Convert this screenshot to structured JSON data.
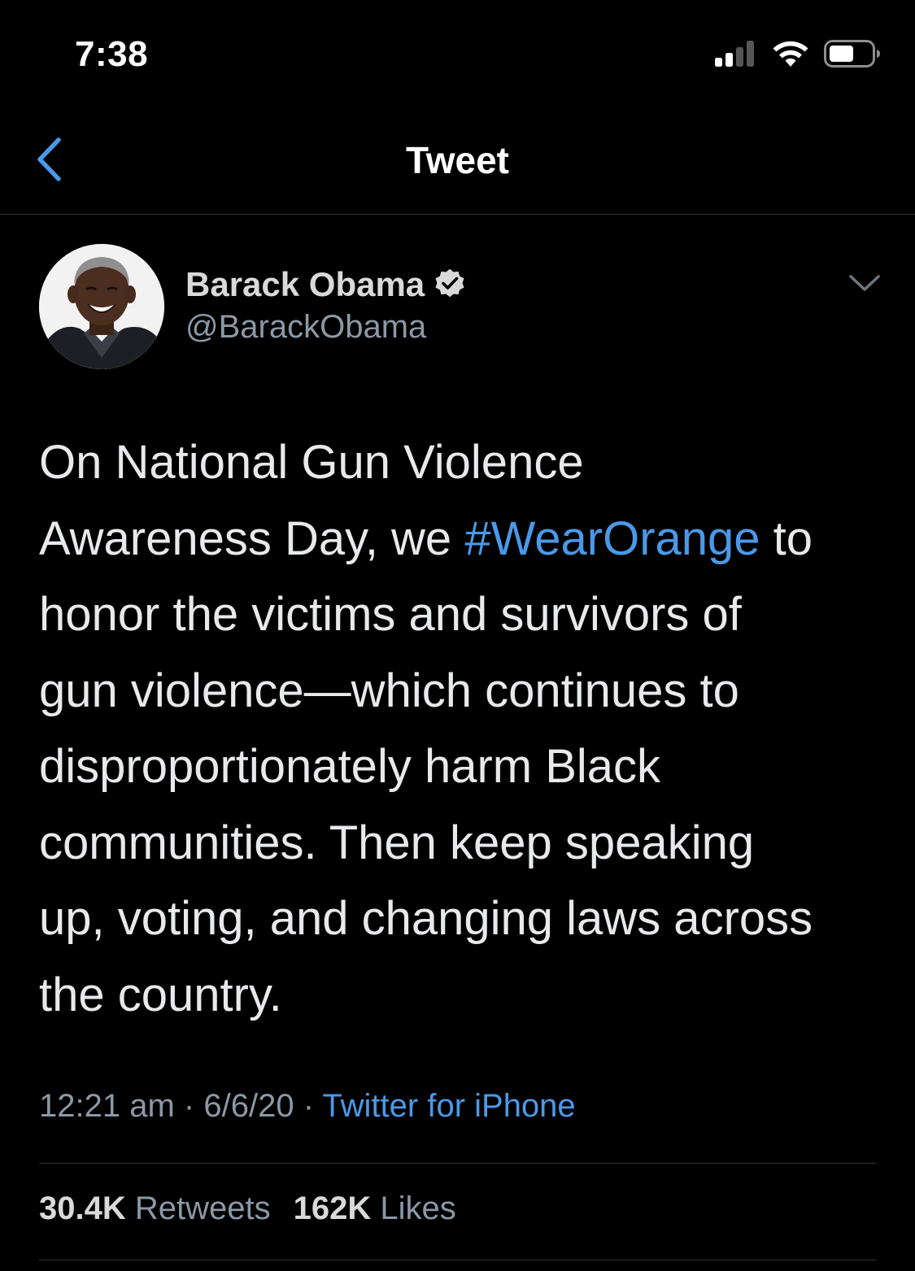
{
  "status_bar": {
    "time": "7:38",
    "icons": [
      "cellular-signal-icon",
      "wifi-icon",
      "battery-icon"
    ]
  },
  "nav": {
    "title": "Tweet",
    "back_icon": "chevron-left-icon"
  },
  "tweet": {
    "author_name": "Barack Obama",
    "verified": true,
    "handle": "@BarackObama",
    "text_lines": [
      {
        "before": "On National Gun Violence",
        "hashtag": "",
        "after": ""
      },
      {
        "before": "Awareness Day, we ",
        "hashtag": "#WearOrange",
        "after": " to"
      },
      {
        "before": "honor the victims and survivors of",
        "hashtag": "",
        "after": ""
      },
      {
        "before": "gun violence—which continues to",
        "hashtag": "",
        "after": ""
      },
      {
        "before": "disproportionately harm Black",
        "hashtag": "",
        "after": ""
      },
      {
        "before": "communities. Then keep speaking",
        "hashtag": "",
        "after": ""
      },
      {
        "before": "up, voting, and changing laws across",
        "hashtag": "",
        "after": ""
      },
      {
        "before": "the country.",
        "hashtag": "",
        "after": ""
      }
    ],
    "time": "12:21 am",
    "separator": "·",
    "date": "6/6/20",
    "source": "Twitter for iPhone",
    "retweets_count": "30.4K",
    "retweets_label": "Retweets",
    "likes_count": "162K",
    "likes_label": "Likes"
  },
  "colors": {
    "background": "#000000",
    "accent": "#4a99e9",
    "secondary_text": "#8b98a5",
    "divider": "#2f3336"
  }
}
